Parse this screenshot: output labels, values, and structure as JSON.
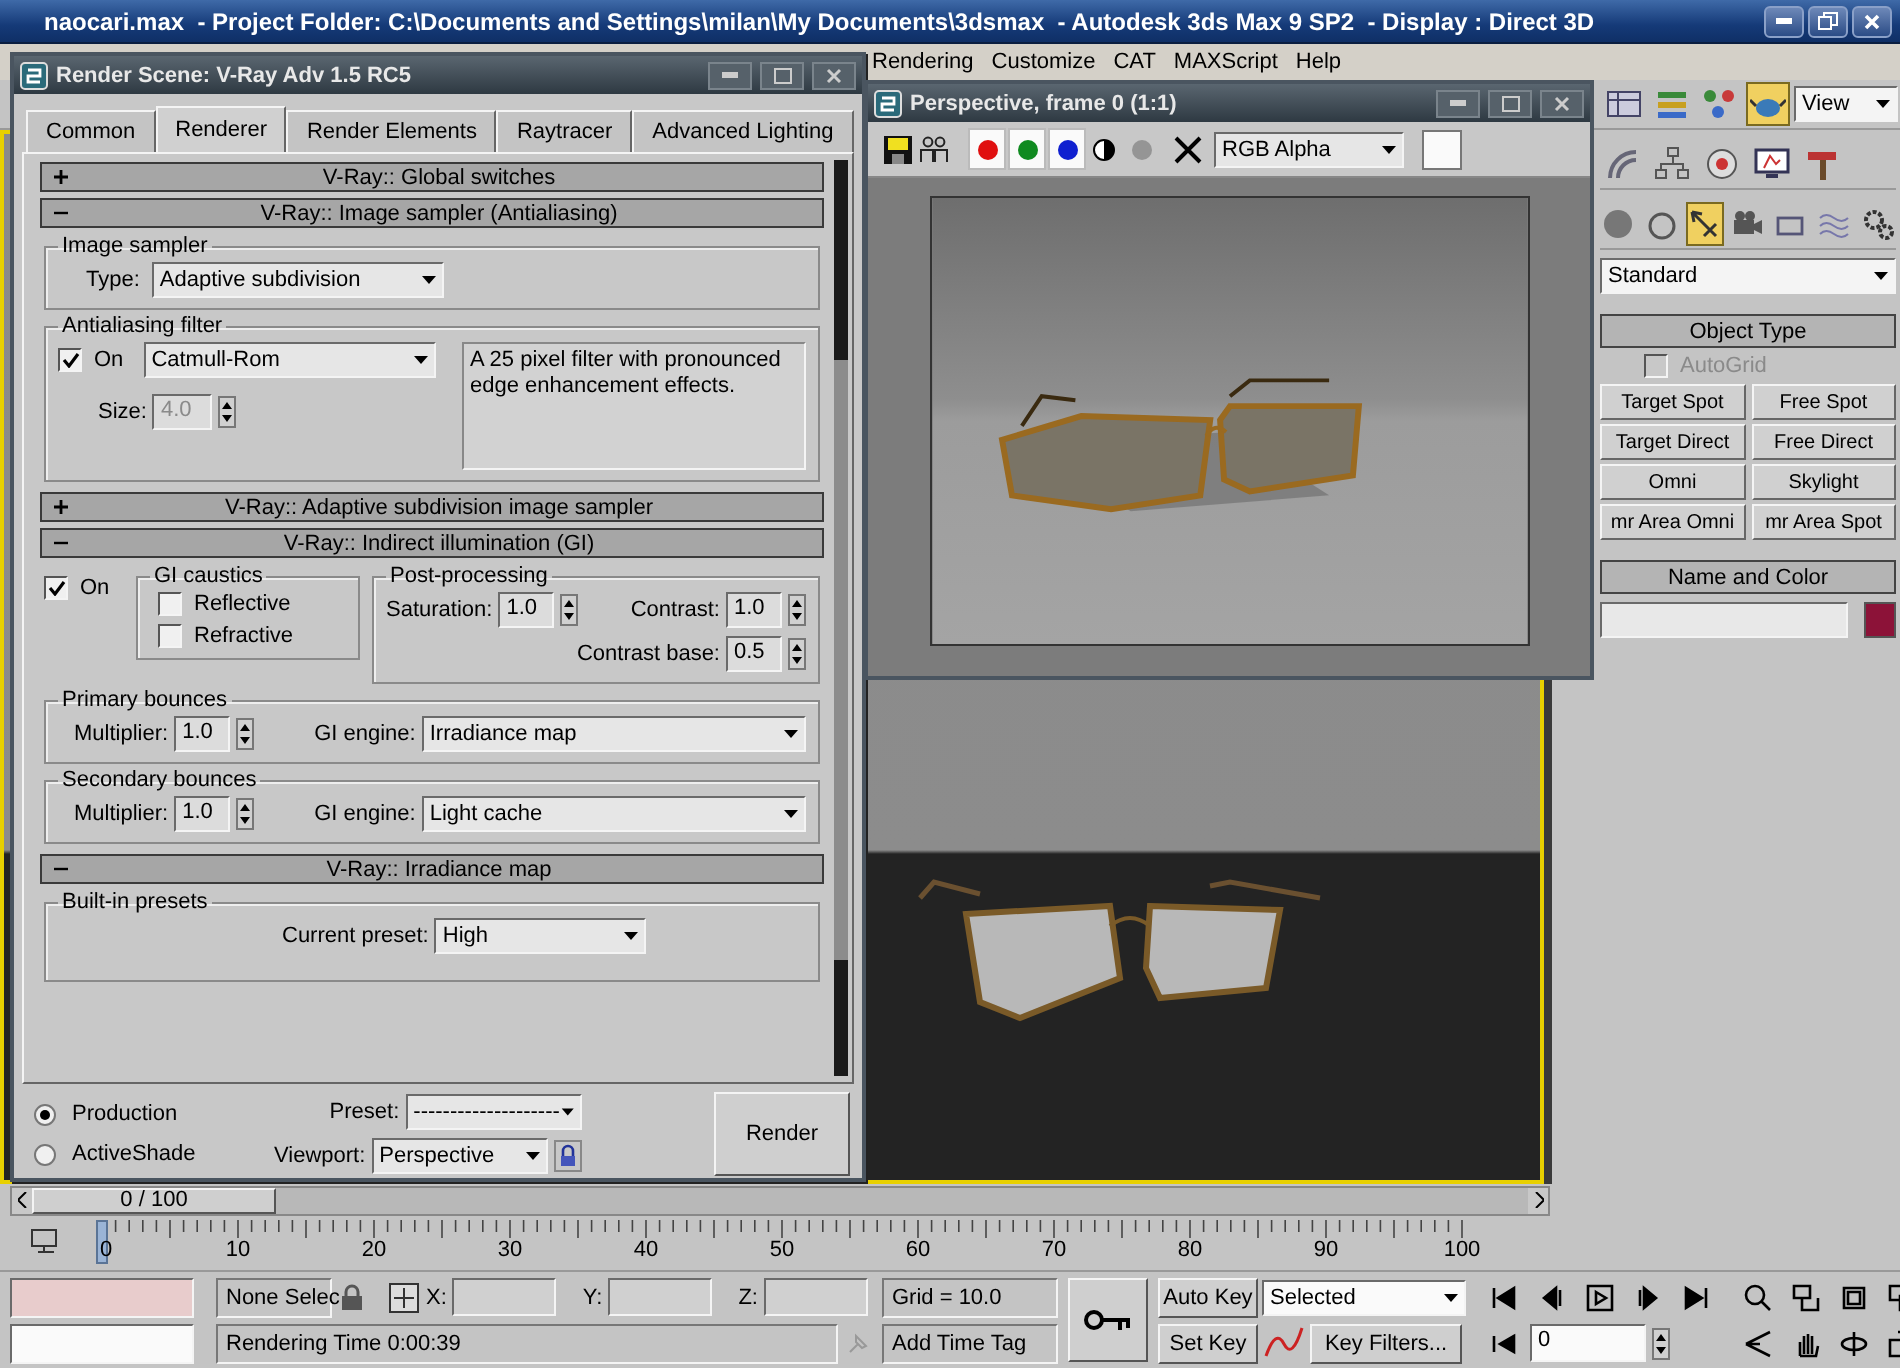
{
  "app_window": {
    "title": "naocari.max  - Project Folder: C:\\Documents and Settings\\milan\\My Documents\\3dsmax  - Autodesk 3ds Max 9 SP2  - Display : Direct 3D"
  },
  "menu_bar": [
    "Rendering",
    "Customize",
    "CAT",
    "MAXScript",
    "Help"
  ],
  "main_toolbar": {
    "view_dropdown": "View"
  },
  "render_scene": {
    "title": "Render Scene: V-Ray Adv 1.5 RC5",
    "tabs": [
      {
        "label": "Common",
        "selected": false
      },
      {
        "label": "Renderer",
        "selected": true
      },
      {
        "label": "Render Elements",
        "selected": false
      },
      {
        "label": "Raytracer",
        "selected": false
      },
      {
        "label": "Advanced Lighting",
        "selected": false
      }
    ],
    "rollouts": [
      {
        "title": "V-Ray:: Global switches",
        "expanded": false
      },
      {
        "kind": "image_sampler",
        "title": "V-Ray:: Image sampler (Antialiasing)",
        "expanded": true,
        "image_sampler": {
          "title": "Image sampler",
          "type_label": "Type:",
          "type_value": "Adaptive subdivision"
        },
        "antialiasing": {
          "title": "Antialiasing filter",
          "on": {
            "label": "On",
            "checked": true
          },
          "filter": "Catmull-Rom",
          "size_label": "Size:",
          "size_value": "4.0",
          "size_disabled": true,
          "description": "A 25 pixel filter with pronounced edge enhancement effects."
        }
      },
      {
        "title": "V-Ray:: Adaptive subdivision image sampler",
        "expanded": false
      },
      {
        "kind": "gi",
        "title": "V-Ray:: Indirect illumination (GI)",
        "expanded": true,
        "on": {
          "label": "On",
          "checked": true
        },
        "caustics": {
          "title": "GI caustics",
          "options": [
            {
              "label": "Reflective",
              "checked": false
            },
            {
              "label": "Refractive",
              "checked": false
            }
          ]
        },
        "post_processing": {
          "title": "Post-processing",
          "saturation_label": "Saturation:",
          "saturation": "1.0",
          "contrast_label": "Contrast:",
          "contrast": "1.0",
          "contrast_base_label": "Contrast base:",
          "contrast_base": "0.5"
        },
        "primary": {
          "title": "Primary bounces",
          "multiplier_label": "Multiplier:",
          "multiplier": "1.0",
          "engine_label": "GI engine:",
          "engine": "Irradiance map"
        },
        "secondary": {
          "title": "Secondary bounces",
          "multiplier_label": "Multiplier:",
          "multiplier": "1.0",
          "engine_label": "GI engine:",
          "engine": "Light cache"
        }
      },
      {
        "kind": "irradiance",
        "title": "V-Ray:: Irradiance map",
        "expanded": true,
        "presets": {
          "title": "Built-in presets",
          "label": "Current preset:",
          "value": "High"
        }
      }
    ],
    "modes": [
      {
        "label": "Production",
        "selected": true
      },
      {
        "label": "ActiveShade",
        "selected": false
      }
    ],
    "preset_label": "Preset:",
    "preset": "--------------------",
    "viewport_label": "Viewport:",
    "viewport": "Perspective",
    "render_button": "Render"
  },
  "render_frame": {
    "title": "Perspective, frame 0 (1:1)",
    "channels": [
      {
        "color": "#e01010",
        "on": true
      },
      {
        "color": "#108a20",
        "on": true
      },
      {
        "color": "#1020d0",
        "on": true
      }
    ],
    "channel_dropdown": "RGB Alpha"
  },
  "command_panel": {
    "category": "Standard",
    "object_type": {
      "title": "Object Type",
      "autogrid": {
        "label": "AutoGrid",
        "checked": false,
        "disabled": true
      },
      "buttons": [
        "Target Spot",
        "Free Spot",
        "Target Direct",
        "Free Direct",
        "Omni",
        "Skylight",
        "mr Area Omni",
        "mr Area Spot"
      ]
    },
    "name_and_color": {
      "title": "Name and Color",
      "color": "#8c1238"
    }
  },
  "viewport": {
    "active": true
  },
  "timeline": {
    "frame_counter": "0 / 100",
    "level": 0,
    "ticks": [
      "0",
      "10",
      "20",
      "30",
      "40",
      "50",
      "60",
      "70",
      "80",
      "90",
      "100"
    ]
  },
  "status_bar": {
    "selection": "None Selec",
    "x_label": "X:",
    "y_label": "Y:",
    "z_label": "Z:",
    "grid": "Grid = 10.0",
    "prompt": "Rendering Time  0:00:39",
    "add_time_tag": "Add Time Tag",
    "auto_key": "Auto Key",
    "set_key": "Set Key",
    "key_mode": "Selected",
    "key_filters": "Key Filters...",
    "frame": "0"
  }
}
